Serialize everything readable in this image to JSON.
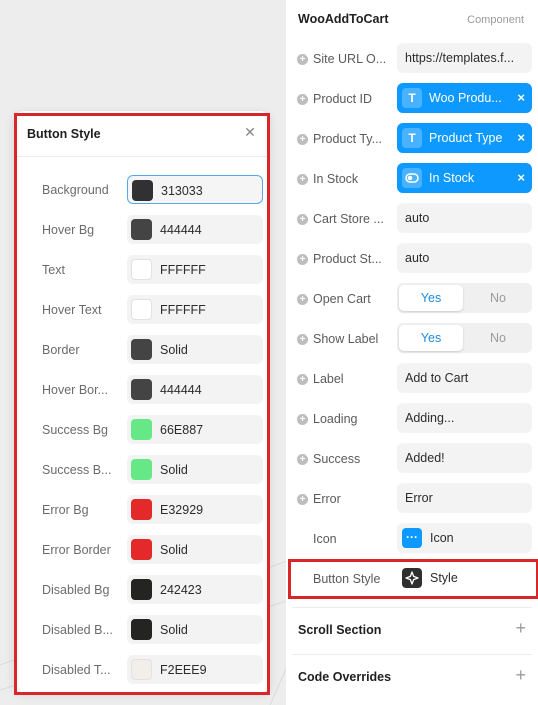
{
  "button_style_popover": {
    "title": "Button Style",
    "close_icon": "close-icon",
    "rows": [
      {
        "label": "Background",
        "value": "313033",
        "color": "#313033",
        "active": true
      },
      {
        "label": "Hover Bg",
        "value": "444444",
        "color": "#444444"
      },
      {
        "label": "Text",
        "value": "FFFFFF",
        "color": "#FFFFFF"
      },
      {
        "label": "Hover Text",
        "value": "FFFFFF",
        "color": "#FFFFFF"
      },
      {
        "label": "Border",
        "value": "Solid",
        "color": "#444444"
      },
      {
        "label": "Hover Bor...",
        "value": "444444",
        "color": "#444444"
      },
      {
        "label": "Success Bg",
        "value": "66E887",
        "color": "#66E887"
      },
      {
        "label": "Success B...",
        "value": "Solid",
        "color": "#66E887"
      },
      {
        "label": "Error Bg",
        "value": "E32929",
        "color": "#E32929"
      },
      {
        "label": "Error Border",
        "value": "Solid",
        "color": "#E32929"
      },
      {
        "label": "Disabled Bg",
        "value": "242423",
        "color": "#242423"
      },
      {
        "label": "Disabled B...",
        "value": "Solid",
        "color": "#242423"
      },
      {
        "label": "Disabled T...",
        "value": "F2EEE9",
        "color": "#F2EEE9"
      }
    ]
  },
  "panel": {
    "title": "WooAddToCart",
    "type_label": "Component",
    "props": {
      "site_url": {
        "label": "Site URL O...",
        "value": "https://templates.f..."
      },
      "product_id": {
        "label": "Product ID",
        "token": "Woo Produ...",
        "icon": "T"
      },
      "product_type": {
        "label": "Product Ty...",
        "token": "Product Type",
        "icon": "T"
      },
      "in_stock": {
        "label": "In Stock",
        "token": "In Stock"
      },
      "cart_store": {
        "label": "Cart Store ...",
        "value": "auto"
      },
      "product_st": {
        "label": "Product St...",
        "value": "auto"
      },
      "open_cart": {
        "label": "Open Cart",
        "yes": "Yes",
        "no": "No"
      },
      "show_label": {
        "label": "Show Label",
        "yes": "Yes",
        "no": "No"
      },
      "label": {
        "label": "Label",
        "value": "Add to Cart"
      },
      "loading": {
        "label": "Loading",
        "value": "Adding..."
      },
      "success": {
        "label": "Success",
        "value": "Added!"
      },
      "error": {
        "label": "Error",
        "value": "Error"
      },
      "icon": {
        "label": "Icon",
        "value": "Icon"
      },
      "button_style": {
        "label": "Button Style",
        "value": "Style"
      }
    },
    "sections": {
      "scroll": "Scroll Section",
      "code": "Code Overrides"
    }
  },
  "colors": {
    "accent": "#0d99ff",
    "highlight": "#d9262b"
  }
}
